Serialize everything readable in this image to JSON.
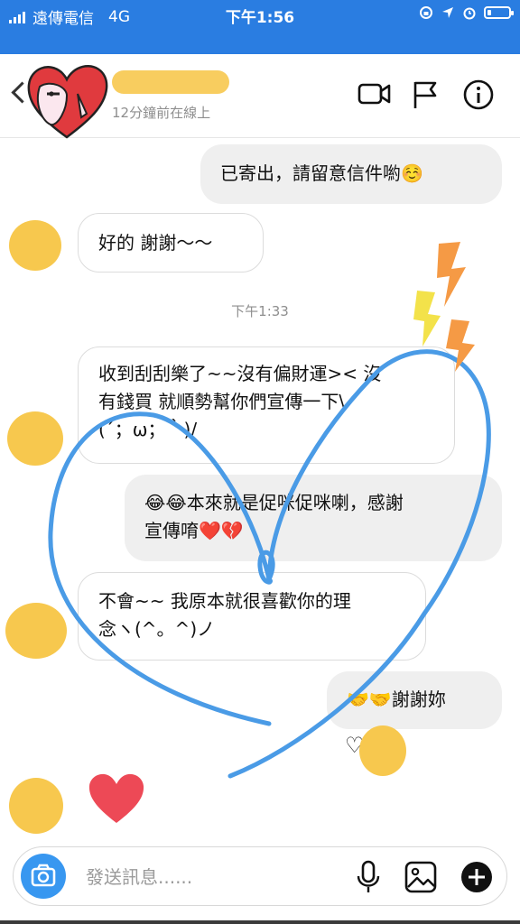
{
  "status_bar": {
    "carrier": "遠傳電信",
    "network": "4G",
    "time": "下午1:56",
    "battery_level": 0.15
  },
  "header": {
    "online_status": "12分鐘前在線上",
    "icons": [
      "video-call-icon",
      "flag-icon",
      "info-icon"
    ]
  },
  "messages": {
    "m1": "已寄出，請留意信件喲☺️",
    "m2": "好的 謝謝～～",
    "timestamp": "下午1:33",
    "m3_line1": "收到刮刮樂了~~沒有偏財運>< 沒",
    "m3_line2": "有錢買 就順勢幫你們宣傳一下\\",
    "m3_line3": "(´；ω；｀)/",
    "m4_line1": "😂😂本來就是促咪促咪喇，感謝",
    "m4_line2": "宣傳唷❤️💔",
    "m5_line1": "不會~~ 我原本就很喜歡你的理",
    "m5_line2": "念ヽ(^。^)ノ",
    "m6": "🤝🤝謝謝妳",
    "reaction": "♡",
    "sticker": "❤️"
  },
  "composer": {
    "placeholder": "發送訊息......"
  },
  "colors": {
    "status_bar": "#2a7de1",
    "accent": "#3897f0",
    "sent_bubble": "#efefef",
    "redaction": "#f7c84e",
    "scribble": "#4a9be6"
  }
}
